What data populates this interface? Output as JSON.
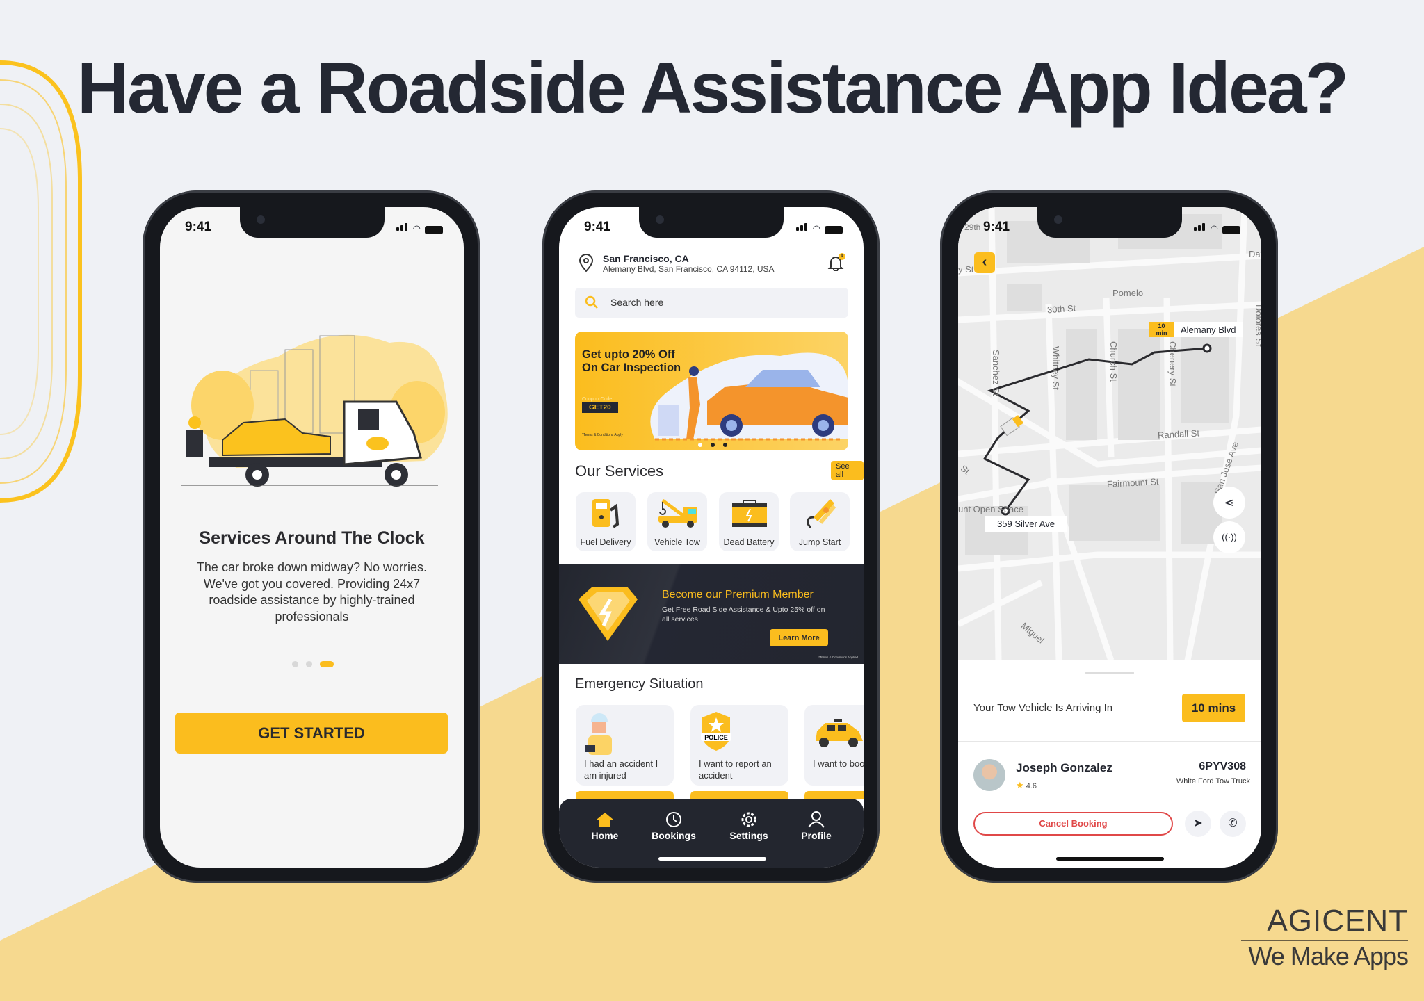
{
  "headline": "Have a Roadside Assistance App Idea?",
  "colors": {
    "accent": "#fbbd1e",
    "dark": "#242833",
    "background": "#eff1f5",
    "background_yellow": "#f6d98f",
    "cancel_red": "#e04848"
  },
  "status_time": "9:41",
  "onboarding": {
    "title": "Services Around The Clock",
    "body": "The car broke down midway? No worries. We've got you covered. Providing 24x7 roadside assistance by highly-trained professionals",
    "page_index": 3,
    "page_count": 3,
    "cta": "GET STARTED"
  },
  "home": {
    "location_title": "San Francisco, CA",
    "location_address": "Alemany Blvd, San Francisco, CA 94112, USA",
    "notification_count": "4",
    "search_placeholder": "Search here",
    "promo": {
      "headline_1": "Get upto 20% Off",
      "headline_2": "On Car Inspection",
      "coupon_label": "Coupon Code",
      "coupon_code": "GET20",
      "terms": "*Terms & Conditions Apply",
      "slide_index": 1,
      "slide_count": 3
    },
    "services_title": "Our Services",
    "see_all": "See all",
    "services": [
      {
        "label": "Fuel Delivery",
        "icon": "fuel-pump-icon"
      },
      {
        "label": "Vehicle Tow",
        "icon": "tow-truck-icon"
      },
      {
        "label": "Dead Battery",
        "icon": "battery-icon"
      },
      {
        "label": "Jump Start",
        "icon": "jumper-clamp-icon"
      }
    ],
    "premium": {
      "title": "Become our Premium Member",
      "text": "Get Free Road Side Assistance & Upto 25% off on all services",
      "button": "Learn More",
      "terms": "*Terms & Conditions Applied"
    },
    "emergency_title": "Emergency Situation",
    "emergency": [
      {
        "label": "I had an accident I am injured",
        "icon": "injured-person-icon"
      },
      {
        "label": "I want to report an accident",
        "icon": "police-badge-icon",
        "badge": "POLICE"
      },
      {
        "label": "I want to book a ride",
        "icon": "taxi-icon"
      }
    ],
    "nav": [
      {
        "label": "Home",
        "icon": "home-icon",
        "active": true
      },
      {
        "label": "Bookings",
        "icon": "history-icon"
      },
      {
        "label": "Settings",
        "icon": "gear-icon"
      },
      {
        "label": "Profile",
        "icon": "user-icon"
      }
    ]
  },
  "tracking": {
    "map_labels": {
      "day": "Day",
      "y_st": "y St",
      "pomelo": "Pomelo",
      "th30": "30th St",
      "dolores": "Dolores St",
      "sanchez": "Sanchez St",
      "whitney": "Whitney St",
      "church": "Church St",
      "chenery": "Chenery St",
      "randall": "Randall St",
      "fairmount": "Fairmount St",
      "open_space": "unt Open Space",
      "san": "San Jose Ave",
      "miguel": "Miguel",
      "st_left": "St",
      "th29": "29th"
    },
    "destination_eta_value": "10",
    "destination_eta_unit": "min",
    "destination": "Alemany Blvd",
    "origin": "359 Silver Ave",
    "arriving_text": "Your Tow Vehicle Is Arriving In",
    "arriving_eta": "10 mins",
    "driver_name": "Joseph Gonzalez",
    "driver_rating": "4.6",
    "plate": "6PYV308",
    "vehicle": "White Ford Tow Truck",
    "cancel": "Cancel Booking"
  },
  "brand": {
    "name": "AGICENT",
    "tagline": "We Make Apps"
  }
}
